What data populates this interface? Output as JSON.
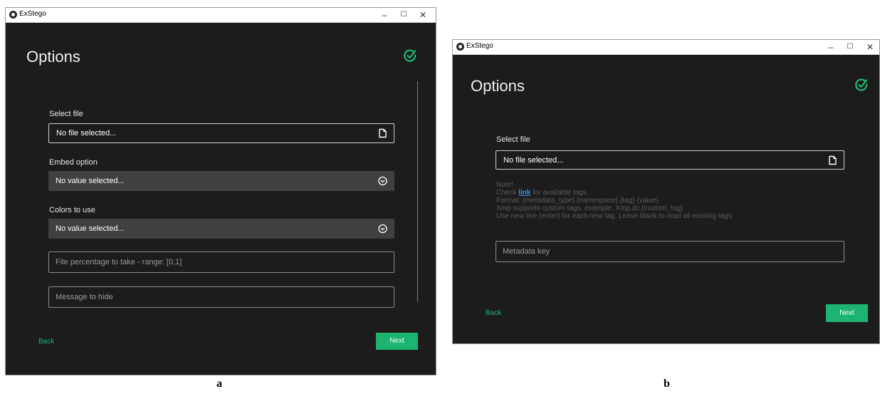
{
  "window_a": {
    "app_title": "ExStego",
    "controls": {
      "minimize": "–",
      "maximize": "☐",
      "close": "✕"
    },
    "heading": "Options",
    "select_file": {
      "label": "Select file",
      "value": "No file selected..."
    },
    "embed_option": {
      "label": "Embed option",
      "value": "No value selected..."
    },
    "colors_to_use": {
      "label": "Colors to use",
      "value": "No value selected..."
    },
    "file_percentage": {
      "placeholder": "File percentage to take - range: [0,1]"
    },
    "message": {
      "placeholder": "Message to hide"
    },
    "back_label": "Back",
    "next_label": "Next"
  },
  "window_b": {
    "app_title": "ExStego",
    "controls": {
      "minimize": "–",
      "maximize": "☐",
      "close": "✕"
    },
    "heading": "Options",
    "select_file": {
      "label": "Select file",
      "value": "No file selected..."
    },
    "note": {
      "line1": "Note!",
      "line2_prefix": "Check ",
      "line2_link": "link",
      "line2_suffix": " for available tags.",
      "line3": "Format: {metadata_type}.{namespace}.{tag} {value}",
      "line4": "Xmp supports custom tags, example: Xmp.dc.{custom_tag}",
      "line5": "Use new line (enter) for each new tag. Leave blank to read all existing tags."
    },
    "metadata_key": {
      "placeholder": "Metadata key"
    },
    "back_label": "Back",
    "next_label": "Next"
  },
  "captions": {
    "a": "a",
    "b": "b"
  },
  "colors": {
    "accent": "#1db370",
    "background": "#1c1c1c",
    "select_bg": "#404040",
    "link": "#3a8de0"
  },
  "icons": {
    "app": "exstego-logo-icon",
    "confirm": "check-circle-icon",
    "file": "file-icon",
    "dropdown": "chevron-down-circle-icon"
  }
}
